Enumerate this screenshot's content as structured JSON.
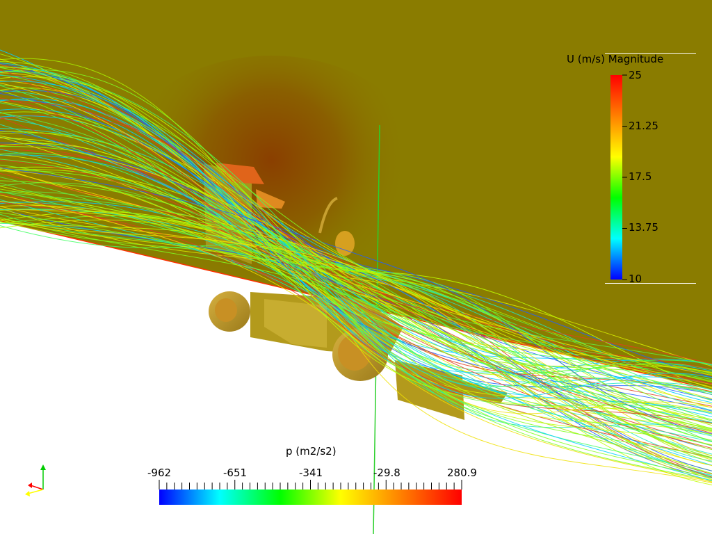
{
  "velocity_legend": {
    "title": "U (m/s) Magnitude",
    "ticks": [
      "25",
      "21.25",
      "17.5",
      "13.75",
      "10"
    ],
    "colors": [
      "#ff0000",
      "#ff8000",
      "#ffff00",
      "#00ff00",
      "#00ffff",
      "#0000ff"
    ]
  },
  "pressure_legend": {
    "title": "p (m2/s2)",
    "ticks": [
      "-962",
      "-651",
      "-341",
      "-29.8",
      "280.9"
    ],
    "colors": [
      "#0000ff",
      "#00ffff",
      "#00ff00",
      "#ffff00",
      "#ff8000",
      "#ff0000"
    ]
  },
  "scene": {
    "background_surface_color": "#8a7c00",
    "ground_color": "#ffffff",
    "car_body_color": "#b39a1c",
    "wheel_color": "#c79a2a",
    "axis_line_color": "#2bd02b",
    "orientation_axes_colors": [
      "#00cc00",
      "#ff0000",
      "#ffff00"
    ]
  }
}
